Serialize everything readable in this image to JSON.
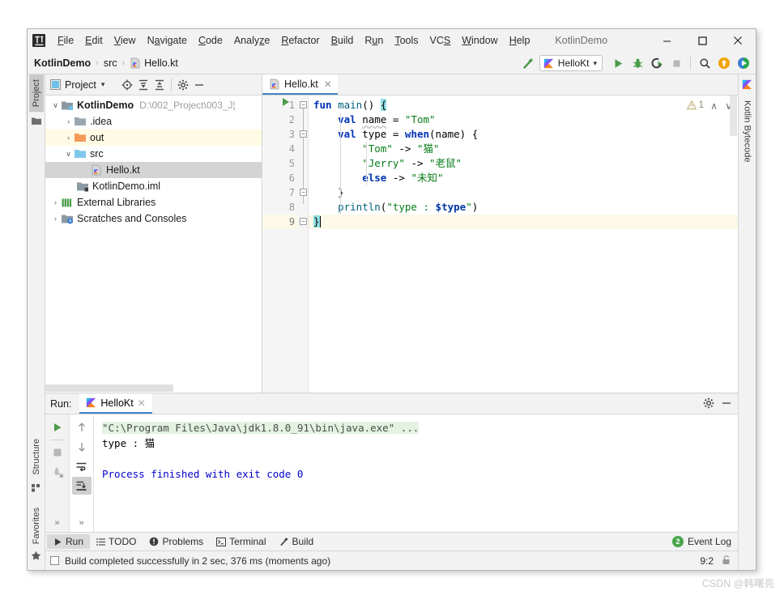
{
  "window": {
    "title": "KotlinDemo",
    "logo_text": "IJ",
    "controls": {
      "minimize": "—",
      "maximize": "□",
      "close": "✕"
    }
  },
  "menu": [
    {
      "label": "File",
      "mnemonic": "F"
    },
    {
      "label": "Edit",
      "mnemonic": "E"
    },
    {
      "label": "View",
      "mnemonic": "V"
    },
    {
      "label": "Navigate",
      "mnemonic": "N"
    },
    {
      "label": "Code",
      "mnemonic": "C"
    },
    {
      "label": "Analyze",
      "mnemonic": "z"
    },
    {
      "label": "Refactor",
      "mnemonic": "R"
    },
    {
      "label": "Build",
      "mnemonic": "B"
    },
    {
      "label": "Run",
      "mnemonic": "n"
    },
    {
      "label": "Tools",
      "mnemonic": "T"
    },
    {
      "label": "VCS",
      "mnemonic": "S"
    },
    {
      "label": "Window",
      "mnemonic": "W"
    },
    {
      "label": "Help",
      "mnemonic": "H"
    }
  ],
  "navbar": {
    "breadcrumb": [
      {
        "label": "KotlinDemo",
        "bold": true
      },
      {
        "label": "src",
        "bold": false
      },
      {
        "label": "Hello.kt",
        "bold": false
      }
    ],
    "separator": "›",
    "run_config_name": "HelloKt",
    "dropdown_caret": "▾",
    "icons": {
      "build": "hammer-icon",
      "run": "run-icon",
      "debug": "debug-icon",
      "run_coverage": "run-with-coverage-icon",
      "stop": "stop-icon",
      "search": "search-everywhere-icon",
      "update": "update-project-icon",
      "ide_feature": "ide-feature-trainer-icon"
    }
  },
  "left_strip": {
    "tabs": [
      {
        "label": "Project",
        "active": true
      },
      {
        "label": "Structure",
        "active": false
      },
      {
        "label": "Favorites",
        "active": false
      }
    ]
  },
  "right_strip": {
    "tabs": [
      {
        "label": "Kotlin Bytecode",
        "active": false
      }
    ]
  },
  "project_panel": {
    "title": "Project",
    "dropdown_caret": "▾",
    "toolbar_icons": [
      "locate-icon",
      "expand-all-icon",
      "collapse-all-icon",
      "settings-gear-icon",
      "hide-icon"
    ],
    "tree": [
      {
        "label": "KotlinDemo",
        "path": "D:\\002_Project\\003_J¦",
        "depth": 0,
        "arrow": "∨",
        "icon": "module-icon",
        "bold": true,
        "state": "normal"
      },
      {
        "label": ".idea",
        "path": "",
        "depth": 1,
        "arrow": "›",
        "icon": "folder-gray-icon",
        "bold": false,
        "state": "normal"
      },
      {
        "label": "out",
        "path": "",
        "depth": 1,
        "arrow": "›",
        "icon": "folder-orange-icon",
        "bold": false,
        "state": "highlight"
      },
      {
        "label": "src",
        "path": "",
        "depth": 1,
        "arrow": "∨",
        "icon": "folder-blue-icon",
        "bold": false,
        "state": "normal"
      },
      {
        "label": "Hello.kt",
        "path": "",
        "depth": 2,
        "arrow": "",
        "icon": "kotlin-file-icon",
        "bold": false,
        "state": "selected"
      },
      {
        "label": "KotlinDemo.iml",
        "path": "",
        "depth": 1,
        "arrow": "",
        "icon": "iml-file-icon",
        "bold": false,
        "state": "normal"
      },
      {
        "label": "External Libraries",
        "path": "",
        "depth": 0,
        "arrow": "›",
        "icon": "libraries-icon",
        "bold": false,
        "state": "normal"
      },
      {
        "label": "Scratches and Consoles",
        "path": "",
        "depth": 0,
        "arrow": "›",
        "icon": "scratches-icon",
        "bold": false,
        "state": "normal"
      }
    ]
  },
  "editor": {
    "tab": {
      "label": "Hello.kt",
      "close": "✕",
      "icon": "kotlin-file-icon"
    },
    "warning_count": "1",
    "warning_icon": "warning-triangle-icon",
    "nav_up": "∧",
    "nav_down": "∨",
    "gutter_run_icon": "run-gutter-icon",
    "lines": [
      {
        "num": "1",
        "current": false
      },
      {
        "num": "2",
        "current": false
      },
      {
        "num": "3",
        "current": false
      },
      {
        "num": "4",
        "current": false
      },
      {
        "num": "5",
        "current": false
      },
      {
        "num": "6",
        "current": false
      },
      {
        "num": "7",
        "current": false
      },
      {
        "num": "8",
        "current": false
      },
      {
        "num": "9",
        "current": true
      }
    ],
    "code": {
      "l1_kw": "fun",
      "l1_name": "main",
      "l1_parens": "()",
      "l1_brace": "{",
      "l2_kw": "val",
      "l2_name": "name",
      "l2_eq": "=",
      "l2_val": "\"Tom\"",
      "l3_kw": "val",
      "l3_name": "type",
      "l3_eq": "=",
      "l3_when": "when",
      "l3_arg": "(name)",
      "l3_brace": "{",
      "l4_key": "\"Tom\"",
      "l4_arrow": "->",
      "l4_val": "\"猫\"",
      "l5_key": "\"Jerry\"",
      "l5_arrow": "->",
      "l5_val": "\"老鼠\"",
      "l6_kw": "else",
      "l6_arrow": "->",
      "l6_val": "\"未知\"",
      "l7_brace": "}",
      "l8_fn": "println",
      "l8_open": "(",
      "l8_str_a": "\"type : ",
      "l8_tmpl": "$type",
      "l8_str_b": "\"",
      "l8_close": ")",
      "l9_brace": "}"
    }
  },
  "run_panel": {
    "label": "Run:",
    "tab": {
      "label": "HelloKt",
      "close": "✕",
      "icon": "kotlin-icon"
    },
    "head_icons": [
      "settings-gear-icon",
      "hide-icon"
    ],
    "toolbar_left": [
      "rerun-icon",
      "stop-icon",
      "dump-threads-icon"
    ],
    "toolbar_right": [
      "up-icon",
      "down-icon",
      "soft-wrap-icon",
      "scroll-to-end-icon"
    ],
    "more": "»",
    "console": {
      "command": "\"C:\\Program Files\\Java\\jdk1.8.0_91\\bin\\java.exe\" ...",
      "output": "type : 猫",
      "blank": "",
      "finished": "Process finished with exit code 0"
    }
  },
  "bottom_bar": {
    "items": [
      {
        "label": "Run",
        "icon": "run-icon",
        "active": true
      },
      {
        "label": "TODO",
        "icon": "todo-icon",
        "active": false
      },
      {
        "label": "Problems",
        "icon": "problems-icon",
        "active": false
      },
      {
        "label": "Terminal",
        "icon": "terminal-icon",
        "active": false
      },
      {
        "label": "Build",
        "icon": "build-hammer-icon",
        "active": false
      }
    ],
    "event_log": {
      "label": "Event Log",
      "count": "2"
    }
  },
  "status_bar": {
    "message": "Build completed successfully in 2 sec, 376 ms (moments ago)",
    "caret_position": "9:2",
    "lock_icon": "unlocked-icon"
  },
  "watermark": "CSDN @韩曙亮",
  "colors": {
    "accent_blue": "#4083c9",
    "keyword": "#0033b3",
    "string": "#067d17",
    "function": "#00627a",
    "selection": "#d4d4d4",
    "highlight_row": "#fffae3",
    "current_line": "#fdf9e8",
    "green_run": "#4a9c4a",
    "console_cmd_bg": "#e3f2e1",
    "console_finished": "#0000cc"
  }
}
